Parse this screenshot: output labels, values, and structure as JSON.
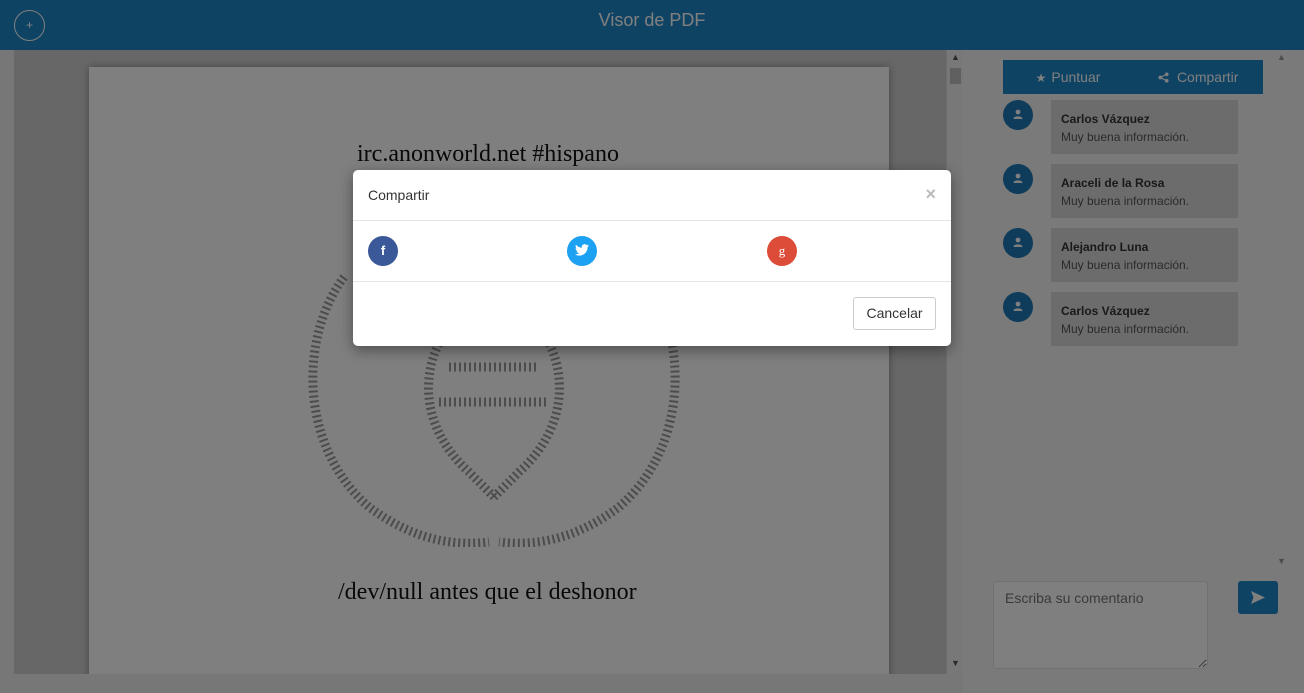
{
  "header": {
    "title": "Visor de PDF",
    "add_button_icon": "+"
  },
  "viewer": {
    "pdf_line_1": "irc.anonworld.net #hispano",
    "pdf_line_2": "/dev/null antes que el deshonor"
  },
  "side": {
    "tabs": [
      {
        "label": "Puntuar",
        "icon": "star-icon"
      },
      {
        "label": "Compartir",
        "icon": "share-icon"
      }
    ],
    "comments": [
      {
        "name": "Carlos Vázquez",
        "text": "Muy buena información."
      },
      {
        "name": "Araceli de la Rosa",
        "text": "Muy buena información."
      },
      {
        "name": "Alejandro Luna",
        "text": "Muy buena información."
      },
      {
        "name": "Carlos Vázquez",
        "text": "Muy buena información."
      }
    ],
    "comment_placeholder": "Escriba su comentario"
  },
  "modal": {
    "title": "Compartir",
    "close": "×",
    "share_icons": [
      "facebook-icon",
      "twitter-icon",
      "google-plus-icon"
    ],
    "facebook_glyph": "f",
    "google_glyph": "g",
    "cancel_label": "Cancelar"
  },
  "colors": {
    "brand": "#1f86c9",
    "facebook": "#3b5998",
    "twitter": "#1da1f2",
    "google": "#dd4b39"
  }
}
